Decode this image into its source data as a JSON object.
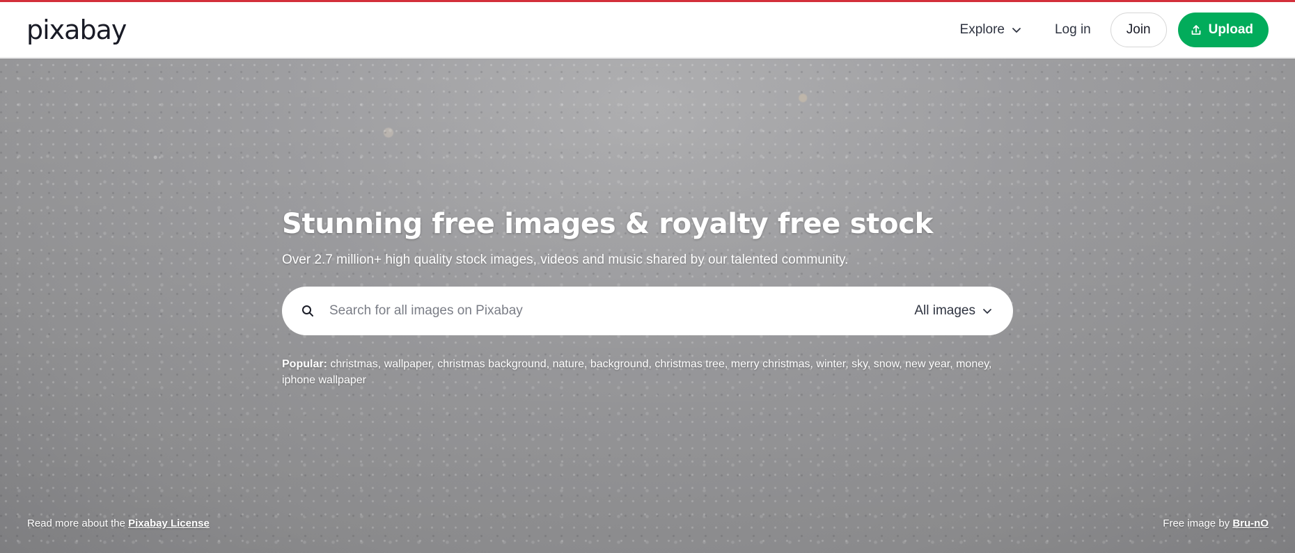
{
  "brand": {
    "logo_text": "pixabay"
  },
  "header": {
    "explore_label": "Explore",
    "login_label": "Log in",
    "join_label": "Join",
    "upload_label": "Upload"
  },
  "hero": {
    "title": "Stunning free images & royalty free stock",
    "subtitle": "Over 2.7 million+ high quality stock images, videos and music shared by our talented community."
  },
  "search": {
    "placeholder": "Search for all images on Pixabay",
    "value": "",
    "type_selected": "All images"
  },
  "popular": {
    "label": "Popular:",
    "tags": [
      "christmas",
      "wallpaper",
      "christmas background",
      "nature",
      "background",
      "christmas tree",
      "merry christmas",
      "winter",
      "sky",
      "snow",
      "new year",
      "money",
      "iphone wallpaper"
    ]
  },
  "footer": {
    "license_prefix": "Read more about the",
    "license_link": "Pixabay License",
    "credit_prefix": "Free image by",
    "credit_author": "Bru-nO"
  },
  "colors": {
    "accent_bar": "#d32f3a",
    "upload_button": "#02ac5b",
    "text_dark": "#191b26"
  },
  "icons": {
    "explore_chevron": "chevron-down-icon",
    "upload": "upload-icon",
    "search": "search-icon",
    "type_chevron": "chevron-down-icon"
  }
}
